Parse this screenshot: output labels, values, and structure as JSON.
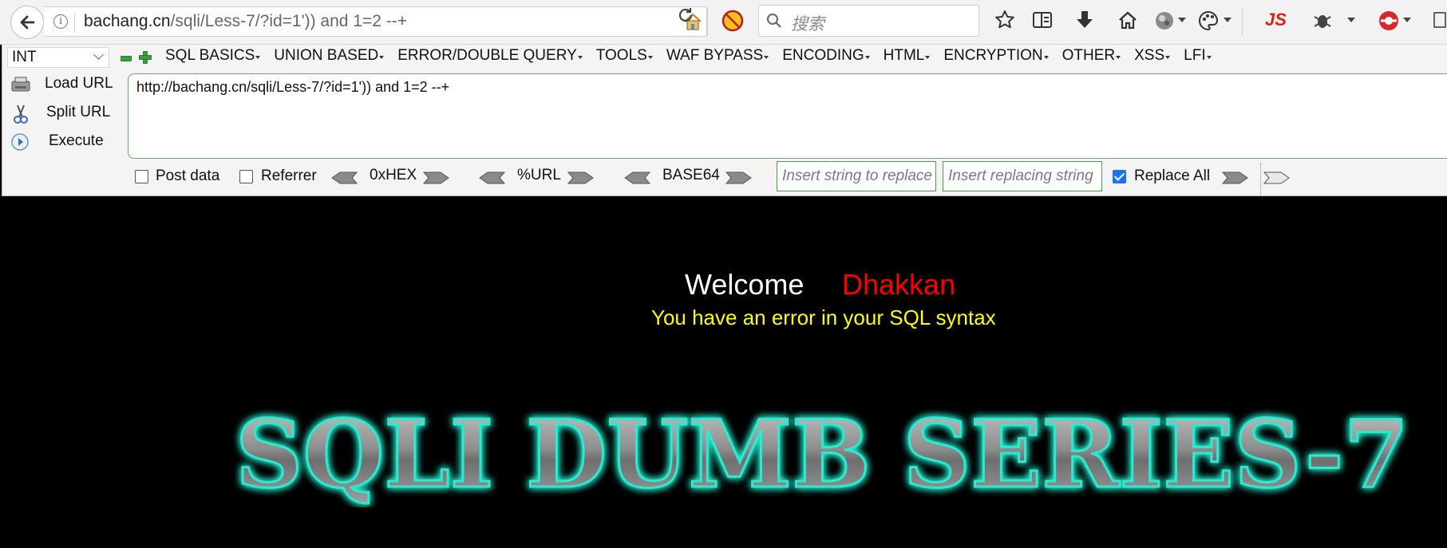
{
  "browser": {
    "url_host": "bachang.cn",
    "url_path": "/sqli/Less-7/?id=1')) and 1=2 --+",
    "search_placeholder": "搜索",
    "js_label": "JS"
  },
  "hackbar": {
    "select_value": "INT",
    "menus": [
      "SQL BASICS",
      "UNION BASED",
      "ERROR/DOUBLE QUERY",
      "TOOLS",
      "WAF BYPASS",
      "ENCODING",
      "HTML",
      "ENCRYPTION",
      "OTHER",
      "XSS",
      "LFI"
    ],
    "load_url": "Load URL",
    "split_url": "Split URL",
    "execute": "Execute",
    "url_field": "http://bachang.cn/sqli/Less-7/?id=1')) and 1=2 --+",
    "post_data": "Post data",
    "referrer": "Referrer",
    "hex": "0xHEX",
    "url_enc": "%URL",
    "base64": "BASE64",
    "insert_placeholder": "Insert string to replace",
    "replacing_placeholder": "Insert replacing string",
    "replace_all": "Replace All",
    "replace_all_checked": true
  },
  "page": {
    "welcome": "Welcome",
    "name": "Dhakkan",
    "error": "You have an error in your SQL syntax",
    "logo_text": "SQLI DUMB SERIES-7"
  },
  "colors": {
    "welcome": "#ffffff",
    "name": "#ff0000",
    "error": "#ffff00",
    "logo_glow": "#27e3c6"
  }
}
